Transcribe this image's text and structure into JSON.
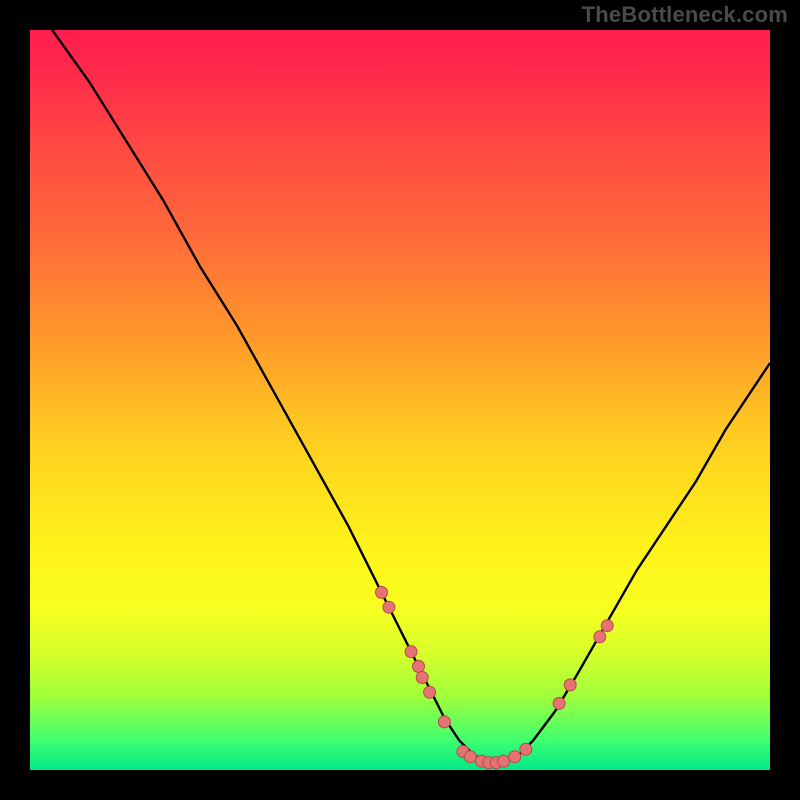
{
  "watermark": "TheBottleneck.com",
  "colors": {
    "dot_fill": "#e57373",
    "dot_stroke": "#b84a4a",
    "curve": "#000000",
    "frame_bg": "#000000"
  },
  "chart_data": {
    "type": "line",
    "title": "",
    "xlabel": "",
    "ylabel": "",
    "xlim": [
      0,
      100
    ],
    "ylim": [
      0,
      100
    ],
    "grid": false,
    "series": [
      {
        "name": "bottleneck-curve",
        "x": [
          3,
          8,
          13,
          18,
          23,
          28,
          33,
          38,
          43,
          46,
          49,
          52,
          54,
          56,
          58,
          60,
          62,
          64,
          66,
          68,
          71,
          74,
          78,
          82,
          86,
          90,
          94,
          98,
          100
        ],
        "y": [
          100,
          93,
          85,
          77,
          68,
          60,
          51,
          42,
          33,
          27,
          21,
          15,
          11,
          7,
          4,
          2,
          1,
          1,
          2,
          4,
          8,
          13,
          20,
          27,
          33,
          39,
          46,
          52,
          55
        ]
      }
    ],
    "dots": [
      {
        "x": 47.5,
        "y": 24
      },
      {
        "x": 48.5,
        "y": 22
      },
      {
        "x": 51.5,
        "y": 16
      },
      {
        "x": 52.5,
        "y": 14
      },
      {
        "x": 53.0,
        "y": 12.5
      },
      {
        "x": 54.0,
        "y": 10.5
      },
      {
        "x": 56.0,
        "y": 6.5
      },
      {
        "x": 58.5,
        "y": 2.5
      },
      {
        "x": 59.5,
        "y": 1.8
      },
      {
        "x": 61.0,
        "y": 1.2
      },
      {
        "x": 62.0,
        "y": 1.0
      },
      {
        "x": 63.0,
        "y": 1.0
      },
      {
        "x": 64.0,
        "y": 1.2
      },
      {
        "x": 65.5,
        "y": 1.8
      },
      {
        "x": 67.0,
        "y": 2.8
      },
      {
        "x": 71.5,
        "y": 9.0
      },
      {
        "x": 73.0,
        "y": 11.5
      },
      {
        "x": 77.0,
        "y": 18.0
      },
      {
        "x": 78.0,
        "y": 19.5
      }
    ],
    "dot_radius": 6
  }
}
